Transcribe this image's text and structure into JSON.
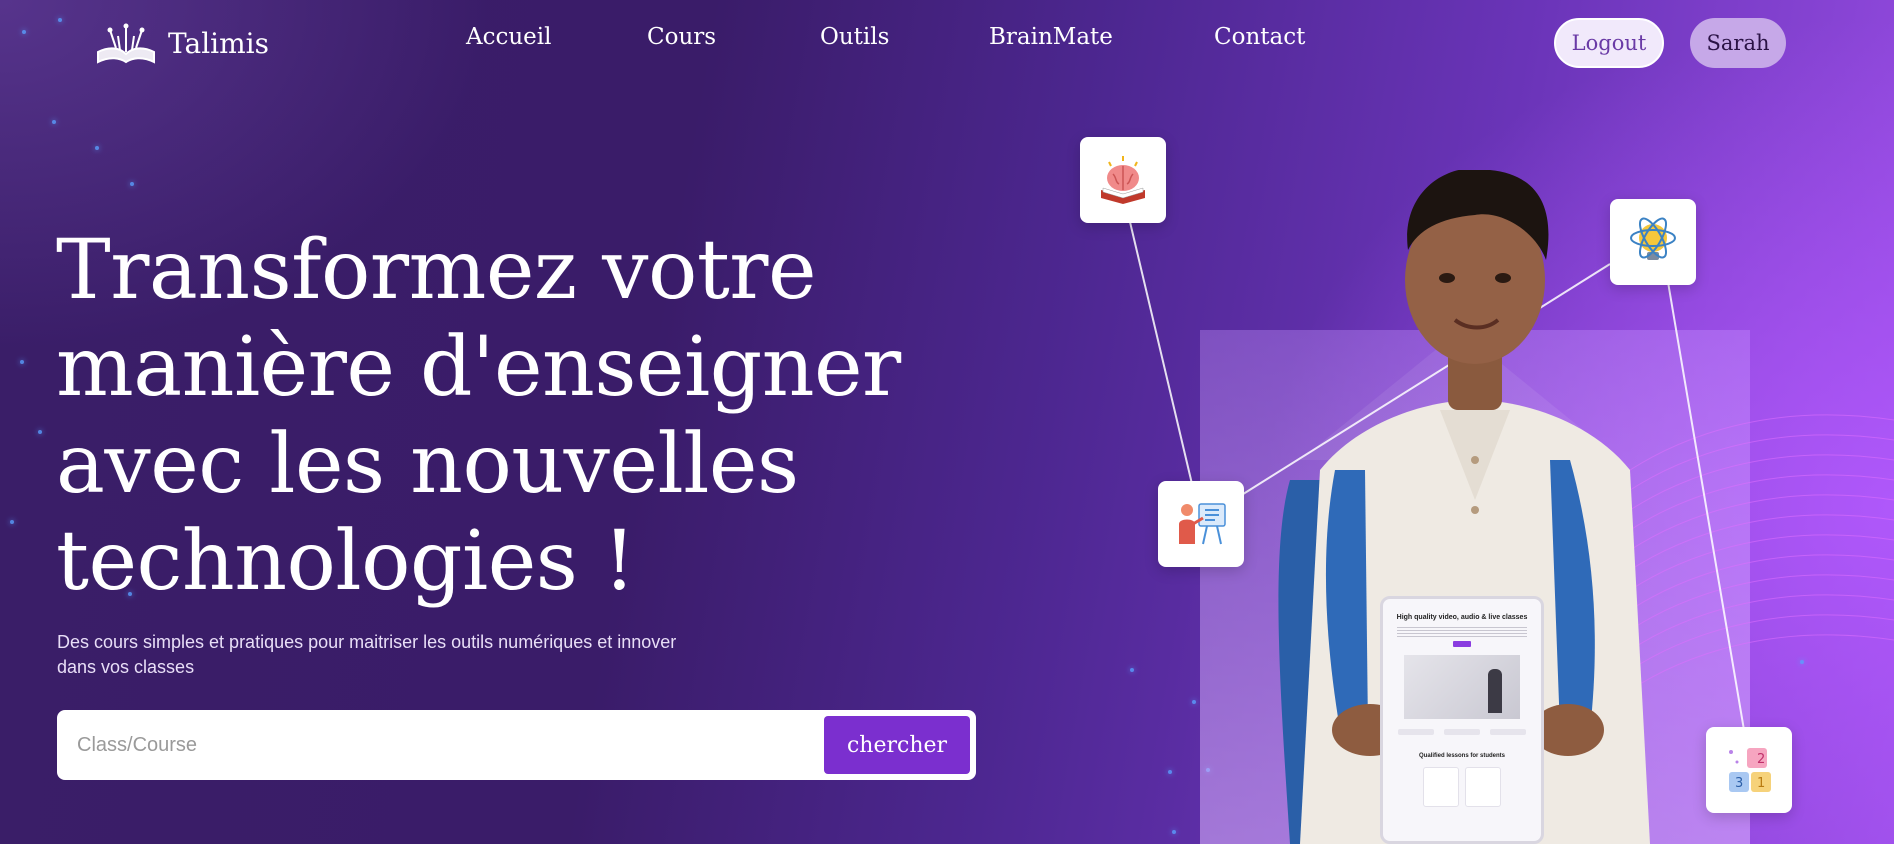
{
  "header": {
    "brand": "Talimis",
    "nav": [
      "Accueil",
      "Cours",
      "Outils",
      "BrainMate",
      "Contact"
    ],
    "logout_label": "Logout",
    "user_label": "Sarah"
  },
  "hero": {
    "title": "Transformez votre manière d'enseigner avec les nouvelles technologies !",
    "subtitle": "Des cours simples et pratiques pour maitriser les outils numériques et innover dans vos classes",
    "search": {
      "placeholder": "Class/Course",
      "value": "",
      "button_label": "chercher"
    }
  },
  "visual": {
    "tablet_heading": "High quality video, audio & live classes",
    "tablet_subheading": "Qualified lessons for students",
    "icons": [
      "brain-book-icon",
      "atom-bulb-icon",
      "teacher-board-icon",
      "number-blocks-icon"
    ]
  },
  "colors": {
    "accent": "#7b2fcf",
    "bg_dark": "#3a1c69",
    "bg_light": "#9a4ee6"
  }
}
